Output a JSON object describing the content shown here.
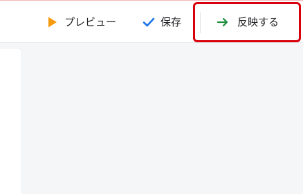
{
  "toolbar": {
    "preview_label": "プレビュー",
    "save_label": "保存",
    "apply_label": "反映する",
    "icons": {
      "preview": "play-icon",
      "save": "check-icon",
      "apply": "arrow-right-icon"
    },
    "colors": {
      "preview_icon": "#f59a0c",
      "save_icon": "#1a73e8",
      "apply_icon": "#1e8e3e",
      "highlight": "#d9000d"
    }
  }
}
